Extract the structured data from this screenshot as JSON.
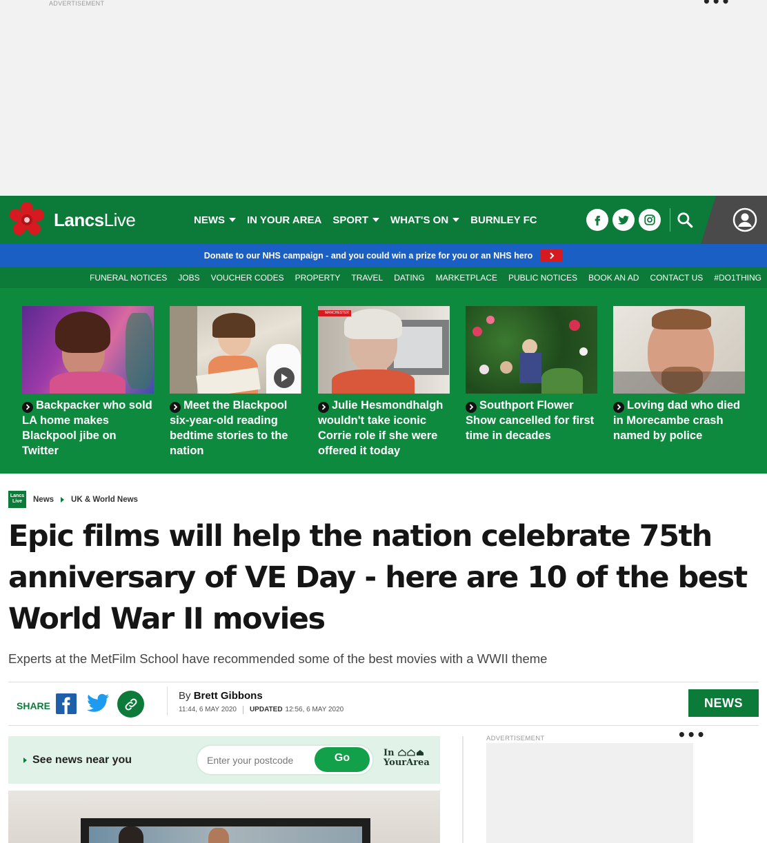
{
  "top_ad": {
    "label": "ADVERTISEMENT",
    "menu": "•••"
  },
  "brand": {
    "name_part1": "Lancs",
    "name_part2": "Live",
    "mini_logo": "Lancs Live"
  },
  "nav": {
    "items": [
      {
        "label": "NEWS",
        "dropdown": true
      },
      {
        "label": "IN YOUR AREA",
        "dropdown": false
      },
      {
        "label": "SPORT",
        "dropdown": true
      },
      {
        "label": "WHAT'S ON",
        "dropdown": true
      },
      {
        "label": "BURNLEY FC",
        "dropdown": false
      }
    ]
  },
  "donate_bar": {
    "text": "Donate to our NHS campaign - and you could win a prize for you or an NHS hero"
  },
  "subnav": {
    "items": [
      "FUNERAL NOTICES",
      "JOBS",
      "VOUCHER CODES",
      "PROPERTY",
      "TRAVEL",
      "DATING",
      "MARKETPLACE",
      "PUBLIC NOTICES",
      "BOOK AN AD",
      "CONTACT US",
      "#DO1THING"
    ]
  },
  "trending": [
    {
      "title": "Backpacker who sold LA home makes Blackpool jibe on Twitter"
    },
    {
      "title": "Meet the Blackpool six-year-old reading bedtime stories to the nation"
    },
    {
      "title": "Julie Hesmondhalgh wouldn't take iconic Corrie role if she were offered it today",
      "thumb_tag": "MANCHESTER"
    },
    {
      "title": "Southport Flower Show cancelled for first time in decades"
    },
    {
      "title": "Loving dad who died in Morecambe crash named by police"
    }
  ],
  "breadcrumb": {
    "items": [
      "News",
      "UK & World News"
    ]
  },
  "article": {
    "headline": "Epic films will help the nation celebrate 75th anniversary of VE Day - here are 10 of the best World War II movies",
    "standfirst": "Experts at the MetFilm School have recommended some of the best movies with a WWII theme",
    "share_label": "SHARE",
    "by_prefix": "By",
    "author": "Brett Gibbons",
    "published": "11:44, 6 MAY 2020",
    "updated_label": "UPDATED",
    "updated": "12:56, 6 MAY 2020",
    "section_tag": "NEWS"
  },
  "near_you": {
    "label": "See news near you",
    "placeholder": "Enter your postcode",
    "go_label": "Go",
    "brand_line1": "In",
    "brand_line2": "YourArea"
  },
  "side_ad": {
    "label": "ADVERTISEMENT",
    "menu": "•••"
  },
  "colors": {
    "brand_green": "#0c7a38",
    "trending_green": "#0e8a3f",
    "donate_blue": "#1a5fc4",
    "rose_red": "#d71920"
  }
}
